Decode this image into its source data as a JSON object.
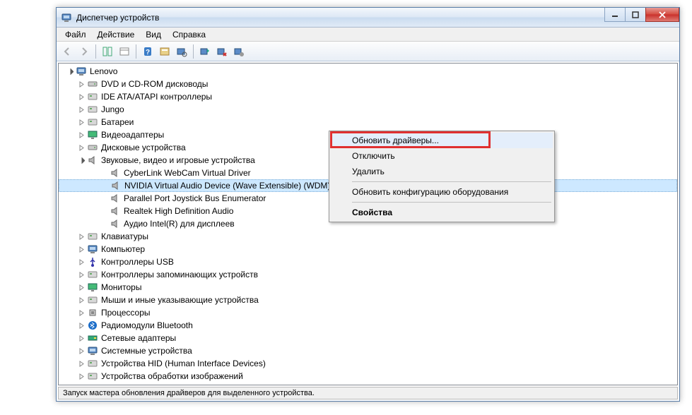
{
  "window": {
    "title": "Диспетчер устройств"
  },
  "menubar": [
    "Файл",
    "Действие",
    "Вид",
    "Справка"
  ],
  "statusbar": "Запуск мастера обновления драйверов для выделенного устройства.",
  "tree": {
    "root": "Lenovo",
    "categories": [
      "DVD и CD-ROM дисководы",
      "IDE ATA/ATAPI контроллеры",
      "Jungo",
      "Батареи",
      "Видеоадаптеры",
      "Дисковые устройства",
      "Звуковые, видео и игровые устройства",
      "Клавиатуры",
      "Компьютер",
      "Контроллеры USB",
      "Контроллеры запоминающих устройств",
      "Мониторы",
      "Мыши и иные указывающие устройства",
      "Процессоры",
      "Радиомодули Bluetooth",
      "Сетевые адаптеры",
      "Системные устройства",
      "Устройства HID (Human Interface Devices)",
      "Устройства обработки изображений"
    ],
    "expanded_category_index": 6,
    "expanded_children": [
      "CyberLink WebCam Virtual Driver",
      "NVIDIA Virtual Audio Device (Wave Extensible) (WDM)",
      "Parallel Port Joystick Bus Enumerator",
      "Realtek High Definition Audio",
      "Аудио Intel(R) для дисплеев"
    ],
    "selected_child_index": 1
  },
  "context_menu": {
    "items": [
      {
        "label": "Обновить драйверы...",
        "highlighted": true
      },
      {
        "label": "Отключить"
      },
      {
        "label": "Удалить"
      },
      {
        "sep": true
      },
      {
        "label": "Обновить конфигурацию оборудования"
      },
      {
        "sep": true
      },
      {
        "label": "Свойства",
        "bold": true
      }
    ]
  }
}
